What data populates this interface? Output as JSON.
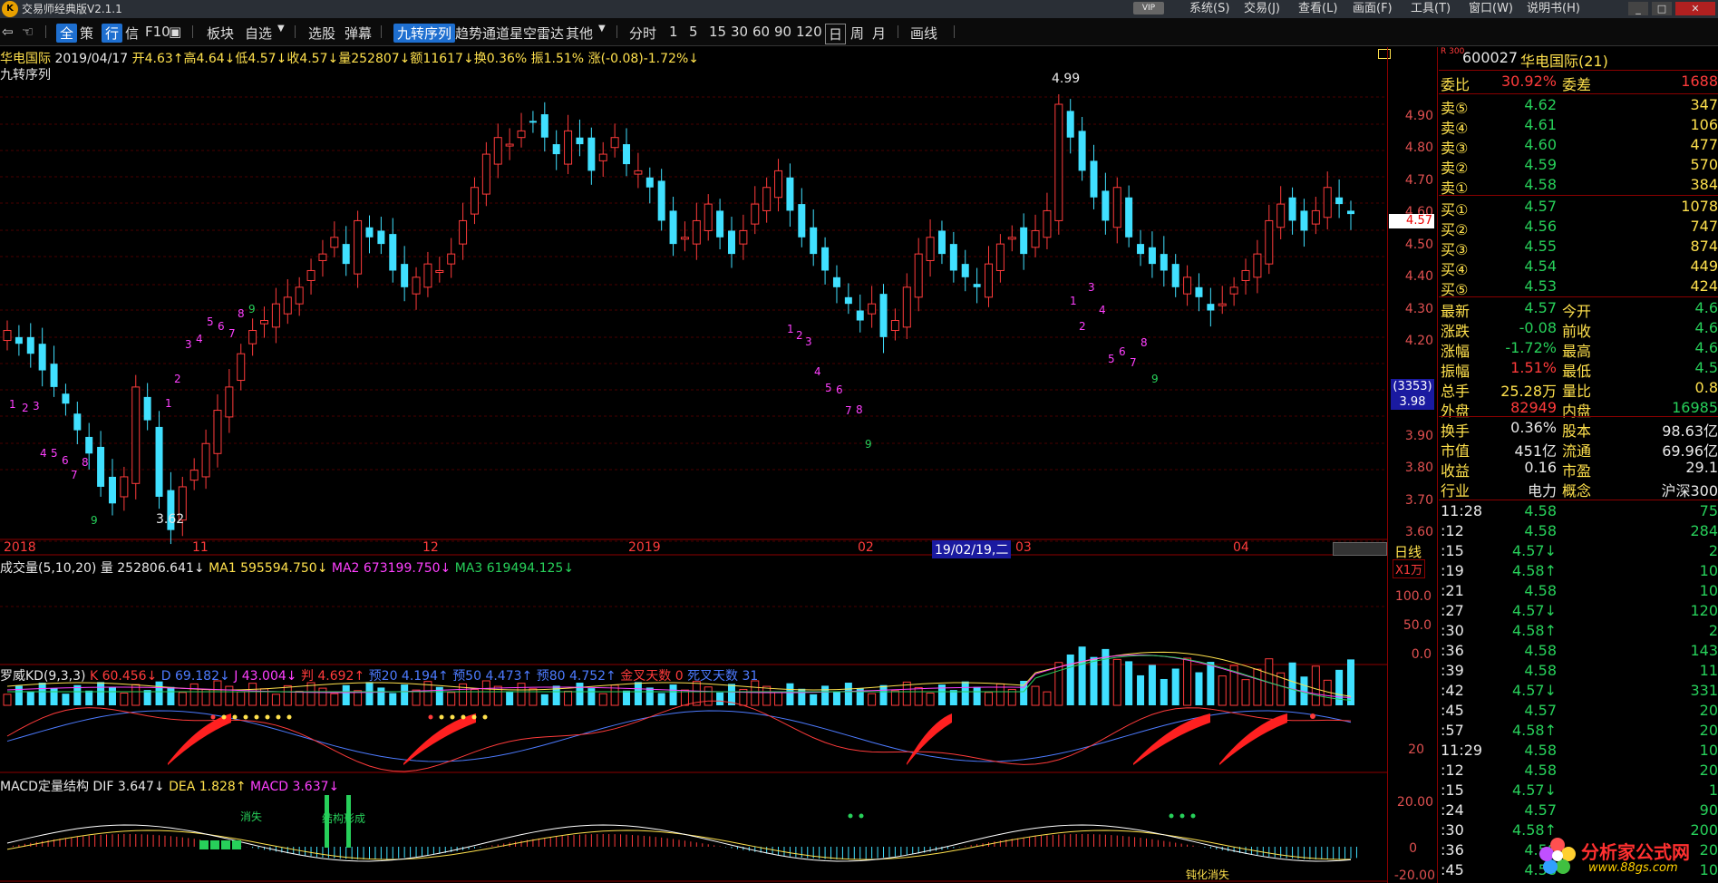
{
  "app": {
    "title": "交易师经典版V2.1.1",
    "logo": "K"
  },
  "menu": [
    "系统(S)",
    "交易(J)",
    "查看(L)",
    "画面(F)",
    "工具(T)",
    "窗口(W)",
    "说明书(H)"
  ],
  "toolbar": {
    "items": [
      "全",
      "策",
      "行",
      "信",
      "F10",
      "板块",
      "自选",
      "选股",
      "弹幕",
      "九转序列",
      "趋势通道",
      "星空雷达",
      "其他",
      "分时",
      "1",
      "5",
      "15",
      "30",
      "60",
      "90",
      "120",
      "日",
      "周",
      "月",
      "画线"
    ],
    "active_indicator": "九转序列",
    "active_period": "日"
  },
  "main_info": {
    "name": "华电国际",
    "date": "2019/04/17",
    "open": "开4.63↑",
    "high": "高4.64↓",
    "low": "低4.57↓",
    "close": "收4.57↓",
    "volume": "量252807↓",
    "amount": "额11617↓",
    "turnover": "换0.36%",
    "amplitude": "振1.51%",
    "change": "涨(-0.08)-1.72%↓",
    "indicator": "九转序列"
  },
  "price_axis": {
    "ticks": [
      "4.90",
      "4.80",
      "4.70",
      "4.60",
      "4.50",
      "4.40",
      "4.30",
      "4.20",
      "3.90",
      "3.80",
      "3.70",
      "3.60"
    ],
    "current_price": "4.57",
    "cursor_count": "(3353)",
    "cursor_price": "3.98"
  },
  "annotations": {
    "high": "4.99",
    "low": "3.62"
  },
  "date_axis": {
    "labels": [
      "2018",
      "11",
      "12",
      "2019",
      "02",
      "03",
      "04"
    ],
    "cursor_date": "19/02/19,二",
    "period": "日线"
  },
  "volume_panel": {
    "title": "成交量(5,10,20)",
    "vol": "量 252806.641↓",
    "ma1": "MA1 595594.750↓",
    "ma2": "MA2 673199.750↓",
    "ma3": "MA3 619494.125↓",
    "unit": "X1万",
    "ticks": [
      "100.0",
      "50.0",
      "0.0"
    ]
  },
  "kd_panel": {
    "title": "罗威KD(9,3,3)",
    "k": "K 60.456↓",
    "d": "D 69.182↓",
    "j": "J 43.004↓",
    "pan": "判 4.692↑",
    "p20": "预20 4.194↑",
    "p50": "预50 4.473↑",
    "p80": "预80 4.752↑",
    "gold": "金叉天数 0",
    "dead": "死叉天数 31",
    "tick": "20"
  },
  "macd_panel": {
    "title": "MACD定量结构",
    "dif": "DIF 3.647↓",
    "dea": "DEA 1.828↑",
    "macd": "MACD 3.637↓",
    "labels": [
      "消失",
      "结构形成",
      "钝化消失"
    ],
    "ticks": [
      "20.00",
      "0",
      "-20.00"
    ]
  },
  "stock": {
    "market": "R 300",
    "code": "600027",
    "name": "华电国际(21)"
  },
  "order_book": {
    "ratio_label": "委比",
    "ratio": "30.92%",
    "diff_label": "委差",
    "diff": "1688",
    "asks": [
      {
        "label": "卖⑤",
        "price": "4.62",
        "vol": "347"
      },
      {
        "label": "卖④",
        "price": "4.61",
        "vol": "106"
      },
      {
        "label": "卖③",
        "price": "4.60",
        "vol": "477"
      },
      {
        "label": "卖②",
        "price": "4.59",
        "vol": "570"
      },
      {
        "label": "卖①",
        "price": "4.58",
        "vol": "384"
      }
    ],
    "bids": [
      {
        "label": "买①",
        "price": "4.57",
        "vol": "1078"
      },
      {
        "label": "买②",
        "price": "4.56",
        "vol": "747"
      },
      {
        "label": "买③",
        "price": "4.55",
        "vol": "874"
      },
      {
        "label": "买④",
        "price": "4.54",
        "vol": "449"
      },
      {
        "label": "买⑤",
        "price": "4.53",
        "vol": "424"
      }
    ]
  },
  "quote": [
    {
      "l1": "最新",
      "v1": "4.57",
      "l2": "今开",
      "v2": "4.6"
    },
    {
      "l1": "涨跌",
      "v1": "-0.08",
      "l2": "前收",
      "v2": "4.6"
    },
    {
      "l1": "涨幅",
      "v1": "-1.72%",
      "l2": "最高",
      "v2": "4.6"
    },
    {
      "l1": "振幅",
      "v1": "1.51%",
      "l2": "最低",
      "v2": "4.5"
    },
    {
      "l1": "总手",
      "v1": "25.28万",
      "l2": "量比",
      "v2": "0.8"
    },
    {
      "l1": "外盘",
      "v1": "82949",
      "l2": "内盘",
      "v2": "16985"
    }
  ],
  "fundamentals": [
    {
      "l1": "换手",
      "v1": "0.36%",
      "l2": "股本",
      "v2": "98.63亿"
    },
    {
      "l1": "市值",
      "v1": "451亿",
      "l2": "流通",
      "v2": "69.96亿"
    },
    {
      "l1": "收益",
      "v1": "0.16",
      "l2": "市盈",
      "v2": "29.1"
    },
    {
      "l1": "行业",
      "v1": "电力",
      "l2": "概念",
      "v2": "沪深300"
    }
  ],
  "ticks": [
    {
      "t": "11:28",
      "p": "4.58",
      "v": "75"
    },
    {
      "t": ":12",
      "p": "4.58",
      "v": "284"
    },
    {
      "t": ":15",
      "p": "4.57↓",
      "v": "2"
    },
    {
      "t": ":19",
      "p": "4.58↑",
      "v": "10"
    },
    {
      "t": ":21",
      "p": "4.58",
      "v": "10"
    },
    {
      "t": ":27",
      "p": "4.57↓",
      "v": "120"
    },
    {
      "t": ":30",
      "p": "4.58↑",
      "v": "2"
    },
    {
      "t": ":36",
      "p": "4.58",
      "v": "143"
    },
    {
      "t": ":39",
      "p": "4.58",
      "v": "11"
    },
    {
      "t": ":42",
      "p": "4.57↓",
      "v": "331"
    },
    {
      "t": ":45",
      "p": "4.57",
      "v": "20"
    },
    {
      "t": ":57",
      "p": "4.58↑",
      "v": "20"
    },
    {
      "t": "11:29",
      "p": "4.58",
      "v": "10"
    },
    {
      "t": ":12",
      "p": "4.58",
      "v": "20"
    },
    {
      "t": ":15",
      "p": "4.57↓",
      "v": "1"
    },
    {
      "t": ":24",
      "p": "4.57",
      "v": "90"
    },
    {
      "t": ":30",
      "p": "4.58↑",
      "v": "200"
    },
    {
      "t": ":36",
      "p": "4.58",
      "v": "20"
    },
    {
      "t": ":45",
      "p": "4.58",
      "v": "10"
    }
  ],
  "watermark": {
    "brand": "分析家公式网",
    "url": "www.88gs.com"
  },
  "colors": {
    "up": "#ff3b3b",
    "down": "#40e0ff",
    "grid": "#5a0000",
    "accent": "#1e6fd0"
  },
  "chart_data": {
    "type": "candlestick",
    "ylim": [
      3.6,
      4.99
    ],
    "seq_numbers": [
      "1",
      "2",
      "3",
      "4",
      "5",
      "6",
      "7",
      "8",
      "9"
    ],
    "candles_close": [
      4.22,
      4.18,
      4.15,
      4.1,
      4.05,
      4.0,
      3.92,
      3.85,
      3.75,
      3.7,
      3.78,
      4.05,
      3.95,
      3.72,
      3.62,
      3.75,
      3.8,
      3.88,
      3.98,
      4.05,
      4.15,
      4.22,
      4.25,
      4.3,
      4.32,
      4.35,
      4.4,
      4.45,
      4.5,
      4.42,
      4.55,
      4.5,
      4.48,
      4.4,
      4.35,
      4.38,
      4.42,
      4.4,
      4.45,
      4.55,
      4.65,
      4.75,
      4.8,
      4.78,
      4.82,
      4.85,
      4.8,
      4.75,
      4.82,
      4.78,
      4.7,
      4.75,
      4.8,
      4.72,
      4.7,
      4.65,
      4.55,
      4.48,
      4.5,
      4.55,
      4.6,
      4.5,
      4.45,
      4.52,
      4.6,
      4.65,
      4.7,
      4.58,
      4.5,
      4.45,
      4.4,
      4.35,
      4.3,
      4.25,
      4.3,
      4.2,
      4.25,
      4.35,
      4.45,
      4.5,
      4.45,
      4.4,
      4.38,
      4.35,
      4.42,
      4.48,
      4.5,
      4.45,
      4.52,
      4.58,
      4.9,
      4.8,
      4.7,
      4.62,
      4.55,
      4.65,
      4.5,
      4.45,
      4.42,
      4.4,
      4.35,
      4.38,
      4.32,
      4.28,
      4.3,
      4.35,
      4.4,
      4.45,
      4.55,
      4.6,
      4.55,
      4.52,
      4.58,
      4.65,
      4.6,
      4.57
    ]
  }
}
